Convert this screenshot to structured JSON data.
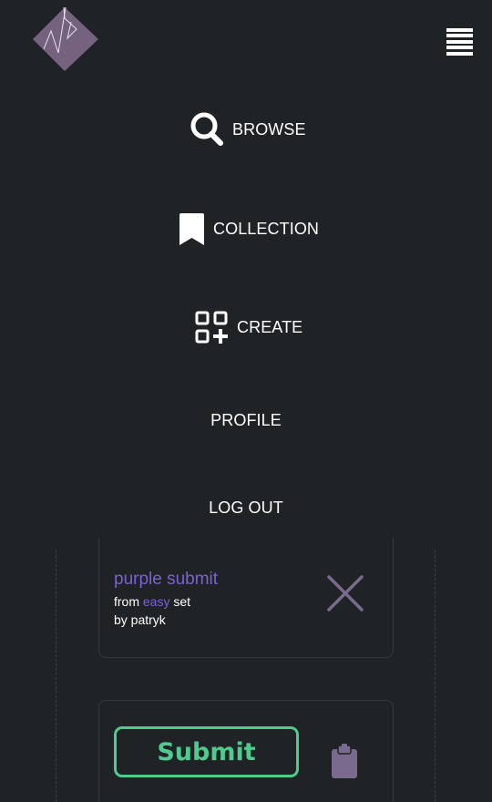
{
  "header": {
    "logo_icon": "diamond-logo-icon",
    "menu_icon": "hamburger-menu-icon"
  },
  "nav": {
    "browse": {
      "label": "BROWSE",
      "icon": "magnifier-icon"
    },
    "collection": {
      "label": "COLLECTION",
      "icon": "bookmark-icon"
    },
    "create": {
      "label": "CREATE",
      "icon": "grid-plus-icon"
    },
    "profile": {
      "label": "PROFILE"
    },
    "logout": {
      "label": "LOG OUT"
    }
  },
  "selected_item": {
    "title": "purple submit",
    "from_prefix": "from ",
    "level": "easy",
    "from_suffix": " set",
    "by": "by patryk",
    "remove_icon": "close-x-icon"
  },
  "actions": {
    "submit_label": "Submit",
    "clipboard_icon": "clipboard-icon"
  },
  "colors": {
    "background": "#202325",
    "accent_purple": "#7b61d6",
    "muted_purple": "#7a6a8e",
    "submit_green": "#4ecb8d",
    "text": "#ffffff"
  }
}
